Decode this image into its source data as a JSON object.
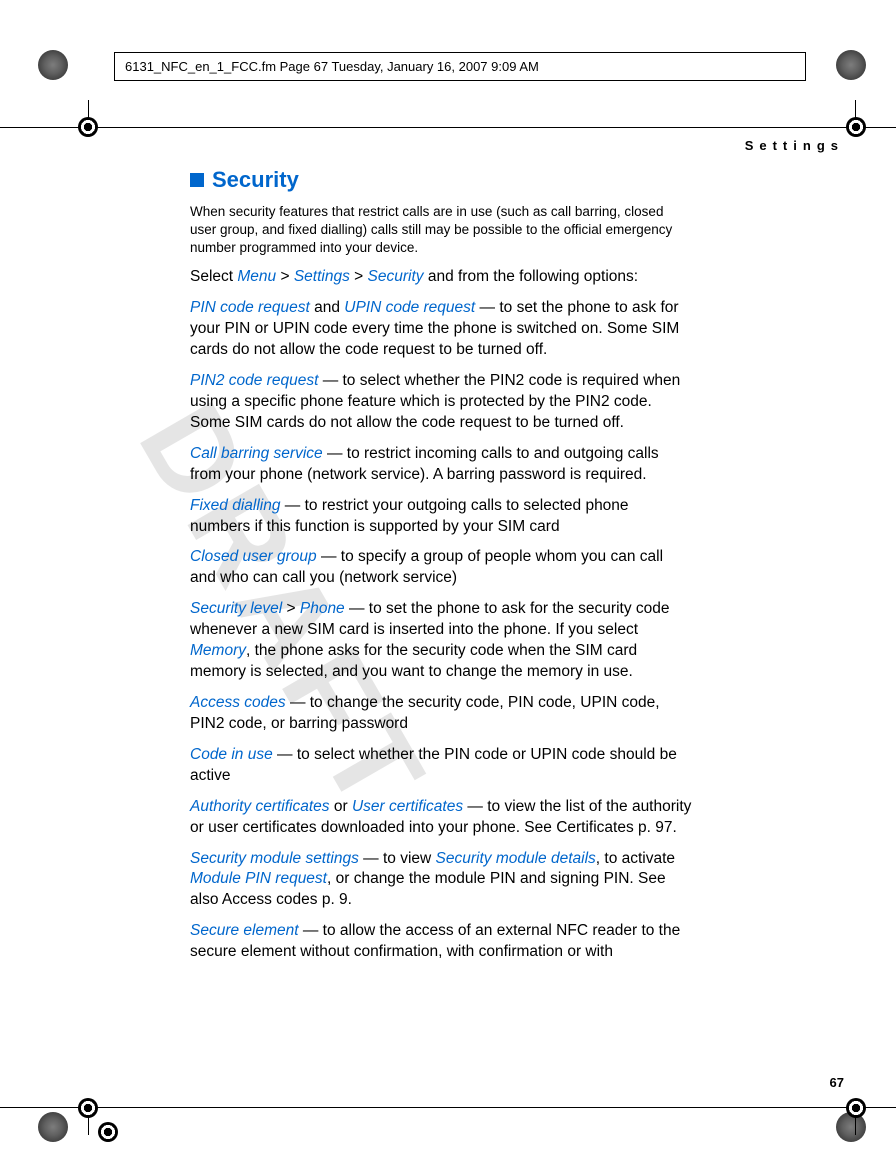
{
  "header_text": "6131_NFC_en_1_FCC.fm  Page 67  Tuesday, January 16, 2007  9:09 AM",
  "section_label": "Settings",
  "heading": "Security",
  "intro": "When security features that restrict calls are in use (such as call barring, closed user group, and fixed dialling) calls still may be possible to the official emergency number programmed into your device.",
  "p_select_1": "Select ",
  "menu": "Menu",
  "gt": " > ",
  "settings": "Settings",
  "security": "Security",
  "p_select_2": " and from the following options:",
  "pin_code_request": "PIN code request",
  "and_sep": " and ",
  "upin_code_request": "UPIN code request",
  "pin_body": " — to set the phone to ask for your PIN or UPIN code every time the phone is switched on. Some SIM cards do not allow the code request to be turned off.",
  "pin2_code_request": "PIN2 code request",
  "pin2_body": " — to select whether the PIN2 code is required when using a specific phone feature which is protected by the PIN2 code. Some SIM cards do not allow the code request to be turned off.",
  "call_barring": "Call barring service",
  "call_barring_body": " — to restrict incoming calls to and outgoing calls from your phone (network service). A barring password is required.",
  "fixed_dialling": "Fixed dialling",
  "fixed_dialling_body": " — to restrict your outgoing calls to selected phone numbers if this function is supported by your SIM card",
  "closed_user_group": "Closed user group",
  "closed_user_group_body": " — to specify a group of people whom you can call and who can call you (network service)",
  "security_level": "Security level",
  "phone": "Phone",
  "security_level_body1": " — to set the phone to ask for the security code whenever a new SIM card is inserted into the phone. If you select ",
  "memory": "Memory",
  "security_level_body2": ", the phone asks for the security code when the SIM card memory is selected, and you want to change the memory in use.",
  "access_codes": "Access codes",
  "access_codes_body": " — to change the security code, PIN code, UPIN code, PIN2 code, or barring password",
  "code_in_use": "Code in use",
  "code_in_use_body": " — to select whether the PIN code or UPIN code should be active",
  "authority_certs": "Authority certificates",
  "or_sep": " or ",
  "user_certs": "User certificates",
  "certs_body": " — to view the list of the authority or user certificates downloaded into your phone. See Certificates p. 97.",
  "sec_mod_settings": "Security module settings",
  "sec_mod_body1": " — to view ",
  "sec_mod_details": "Security module details",
  "sec_mod_body2": ", to activate ",
  "module_pin": "Module PIN request",
  "sec_mod_body3": ", or change the module PIN and signing PIN. See also Access codes p. 9.",
  "secure_element": "Secure element",
  "secure_element_body": " —  to allow the access of an external NFC reader to the secure element without confirmation, with confirmation or with",
  "page_number": "67",
  "watermark": "DRAFT"
}
